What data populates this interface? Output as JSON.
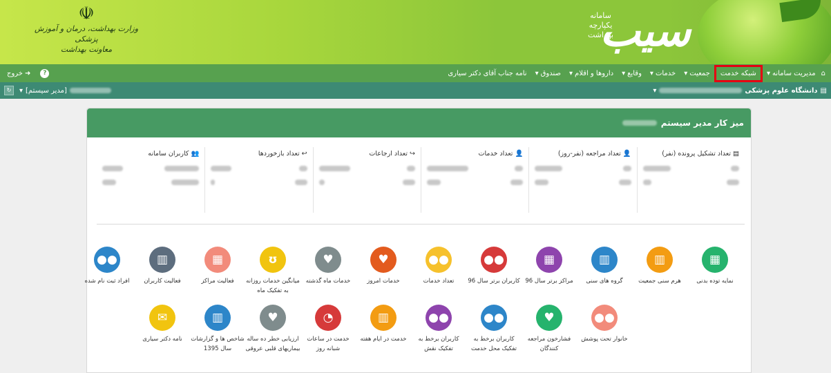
{
  "banner": {
    "emblem": "☫",
    "ministry_line1": "وزارت بهداشت، درمان و آموزش پزشکی",
    "ministry_line2": "معاونت بهداشت",
    "sib_brand": "سیب",
    "sib_sub1": "سامانه",
    "sib_sub2": "یکپارچه",
    "sib_sub3": "بهداشت"
  },
  "nav": {
    "home_icon": "⌂",
    "items": [
      {
        "label": "مدیریت سامانه",
        "arrow": "▾"
      },
      {
        "label": "شبکه خدمت",
        "arrow": ""
      },
      {
        "label": "جمعیت",
        "arrow": "▾"
      },
      {
        "label": "خدمات",
        "arrow": "▾"
      },
      {
        "label": "وقایع",
        "arrow": "▾"
      },
      {
        "label": "داروها و اقلام",
        "arrow": "▾"
      },
      {
        "label": "صندوق",
        "arrow": "▾"
      },
      {
        "label": "نامه جناب آقای دکتر سیاری",
        "arrow": ""
      }
    ],
    "help_icon": "?",
    "logout_label": "خروج",
    "logout_icon": "➜"
  },
  "subbar": {
    "university_label": "دانشگاه علوم پزشکی",
    "university_icon": "▤",
    "dropdown_arrow": "▾",
    "system_role": "[مدیر سیستم]",
    "sys_box_icon": "↻"
  },
  "panel": {
    "title": "میز کار مدیر سیستم"
  },
  "stats": [
    {
      "title": "تعداد تشکیل پرونده (نفر)",
      "icon": "▤"
    },
    {
      "title": "تعداد مراجعه (نفر-روز)",
      "icon": "👤"
    },
    {
      "title": "تعداد خدمات",
      "icon": "👤"
    },
    {
      "title": "تعداد ارجاعات",
      "icon": "↪"
    },
    {
      "title": "تعداد بازخوردها",
      "icon": "↩"
    },
    {
      "title": "کاربران سامانه",
      "icon": "👥"
    }
  ],
  "tiles_row1": [
    {
      "label": "نمایه توده بدنی",
      "color": "#26b36d",
      "icon": "▦"
    },
    {
      "label": "هرم سنی جمعیت",
      "color": "#f39c12",
      "icon": "▥"
    },
    {
      "label": "گروه های سنی",
      "color": "#2d86c9",
      "icon": "▥"
    },
    {
      "label": "مراکز برتر سال 96",
      "color": "#8e44ad",
      "icon": "▦"
    },
    {
      "label": "کاربران برتر سال 96",
      "color": "#d63a3a",
      "icon": "●●"
    },
    {
      "label": "تعداد خدمات",
      "color": "#f6c12c",
      "icon": "●●"
    },
    {
      "label": "خدمات امروز",
      "color": "#e35b1e",
      "icon": "♥"
    },
    {
      "label": "خدمات ماه گذشته",
      "color": "#7f8c8d",
      "icon": "♥"
    },
    {
      "label": "میانگین خدمات روزانه به تفکیک ماه",
      "color": "#f1c40f",
      "icon": "ʊ"
    },
    {
      "label": "فعالیت مراکز",
      "color": "#f28b7b",
      "icon": "▦"
    },
    {
      "label": "فعالیت کاربران",
      "color": "#5d6d7e",
      "icon": "▥"
    },
    {
      "label": "افراد ثبت نام شده",
      "color": "#2d86c9",
      "icon": "●●"
    }
  ],
  "tiles_row2": [
    {
      "label": "خانوار تحت پوشش",
      "color": "#f28b7b",
      "icon": "●●"
    },
    {
      "label": "فشارخون مراجعه کنندگان",
      "color": "#26b36d",
      "icon": "♥"
    },
    {
      "label": "کاربران برخط به تفکیک محل خدمت",
      "color": "#2d86c9",
      "icon": "●●"
    },
    {
      "label": "کاربران برخط به تفکیک نقش",
      "color": "#8e44ad",
      "icon": "●●"
    },
    {
      "label": "خدمت در ایام هفته",
      "color": "#f39c12",
      "icon": "▥"
    },
    {
      "label": "خدمت در ساعات شبانه روز",
      "color": "#d63a3a",
      "icon": "◔"
    },
    {
      "label": "ارزیابی خطر ده ساله بیماریهای قلبی عروقی",
      "color": "#7f8c8d",
      "icon": "♥"
    },
    {
      "label": "شاخص ها و گزارشات سال 1395",
      "color": "#2d86c9",
      "icon": "▥"
    },
    {
      "label": "نامه دکتر سیاری",
      "color": "#f1c40f",
      "icon": "✉"
    }
  ]
}
